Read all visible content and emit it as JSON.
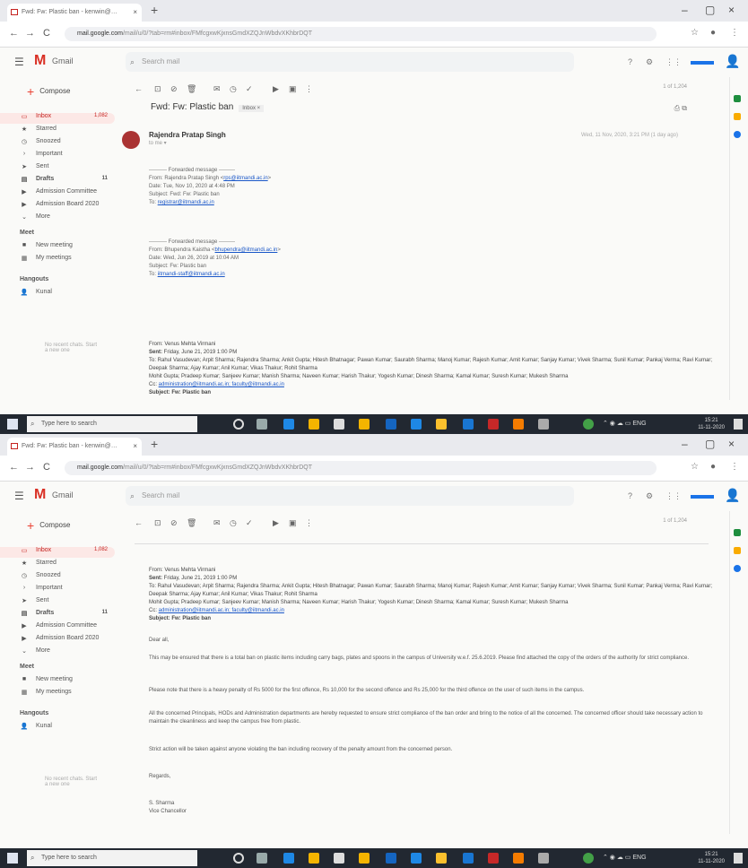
{
  "tab": {
    "title": "Fwd: Fw: Plastic ban - kenwin@…",
    "close": "×",
    "new": "+"
  },
  "window": {
    "minimize": "–",
    "maximize": "▢",
    "close": "×"
  },
  "nav": {
    "back": "←",
    "forward": "→",
    "reload": "C"
  },
  "address": {
    "url_host": "mail.google.com",
    "url_rest": "/mail/u/0/?tab=rm#inbox/FMfcgxwKjxnsGmdXZQJnWbdvXKhbrDQT",
    "star": "☆",
    "profile": "●",
    "menu": "⋮"
  },
  "gmail": {
    "logo": "M",
    "wordmark": "Gmail",
    "search_placeholder": "Search mail",
    "help": "?",
    "settings": "⚙",
    "apps": "⋮⋮"
  },
  "sidebar": {
    "compose": "Compose",
    "items": [
      {
        "icon": "▭",
        "label": "Inbox",
        "count": "1,082",
        "active": true
      },
      {
        "icon": "★",
        "label": "Starred",
        "count": ""
      },
      {
        "icon": "◷",
        "label": "Snoozed",
        "count": ""
      },
      {
        "icon": "›",
        "label": "Important",
        "count": ""
      },
      {
        "icon": "➤",
        "label": "Sent",
        "count": ""
      },
      {
        "icon": "▤",
        "label": "Drafts",
        "count": "11"
      },
      {
        "icon": "▶",
        "label": "Admission Committee",
        "count": ""
      },
      {
        "icon": "▶",
        "label": "Admission Board 2020",
        "count": ""
      },
      {
        "icon": "⌄",
        "label": "More",
        "count": ""
      }
    ],
    "meet_heading": "Meet",
    "meet_items": [
      {
        "icon": "■",
        "label": "New meeting"
      },
      {
        "icon": "▦",
        "label": "My meetings"
      }
    ],
    "hangouts_heading": "Hangouts",
    "hangouts_user": "Kunal",
    "footer": "No recent chats. Start a new one"
  },
  "toolbar": {
    "icons": [
      "←",
      "⊡",
      "⊘",
      "🗑",
      "✉",
      "◷",
      "✓",
      "▶",
      "▣",
      "⋮"
    ],
    "pagecount": "1 of 1,204"
  },
  "email": {
    "subject": "Fwd: Fw: Plastic ban",
    "subject_tag": "Inbox ×",
    "sender": "Rajendra Pratap Singh",
    "sender_to": "to me ▾",
    "date": "Wed, 11 Nov, 2020, 3:21 PM (1 day ago)",
    "fwd1": {
      "marker": "---------- Forwarded message ---------",
      "from": "From: Rajendra Pratap Singh <",
      "from_link": "rps@iitmandi.ac.in",
      "date": "Date: Tue, Nov 10, 2020 at 4:48 PM",
      "subject": "Subject: Fwd: Fw: Plastic ban",
      "to_label": "To: ",
      "to_link": "registrar@iitmandi.ac.in"
    },
    "fwd2": {
      "marker": "---------- Forwarded message ---------",
      "from": "From: Bhupendra Kaistha <",
      "from_link": "bhupendra@iitmandi.ac.in",
      "date": "Date: Wed, Jun 26, 2019 at 10:04 AM",
      "subject": "Subject: Fw: Plastic ban",
      "to_label": "To: ",
      "to_link": "iitmandi-staff@iitmandi.ac.in"
    },
    "meta": {
      "from": "From: Venus Mehta Virmani",
      "sent_label": "Sent:",
      "sent": " Friday, June 21, 2019 1:00 PM",
      "to_line": "To: Rahul Vasudevan; Arpit Sharma; Rajendra Sharma; Ankit Gupta; Hitesh Bhatnagar; Pawan Kumar; Saurabh Sharma; Manoj Kumar; Rajesh Kumar; Amit Kumar; Sanjay Kumar; Vivek Sharma; Sunil Kumar; Pankaj Verma; Ravi Kumar; Deepak Sharma; Ajay Kumar; Anil Kumar; Vikas Thakur; Rohit Sharma",
      "to_line2": "Mohit Gupta; Pradeep Kumar; Sanjeev Kumar; Manish Sharma; Naveen Kumar; Harish Thakur; Yogesh Kumar; Dinesh Sharma; Kamal Kumar; Suresh Kumar; Mukesh Sharma",
      "cc_label": "Cc: ",
      "cc_link": "administration@iitmandi.ac.in; faculty@iitmandi.ac.in",
      "subject": "Subject: Fw: Plastic ban"
    },
    "greeting": "Dear all,",
    "body": [
      "This may be ensured that there is a total ban on plastic items including carry bags, plates and spoons in the campus of University w.e.f. 25.6.2019. Please find attached the copy of the orders of the authority for strict compliance.",
      "Please note that there is a heavy penalty of Rs 5000 for the first offence, Rs 10,000 for the second offence and Rs 25,000 for the third offence on the user of such items in the campus.",
      "All the concerned Principals, HODs and Administration departments are hereby requested to ensure strict compliance of the ban order and bring to the notice of all the concerned. The concerned officer should take necessary action to maintain the cleanliness and keep the campus free from plastic.",
      "Strict action will be taken against anyone violating the ban including recovery of the penalty amount from the concerned person."
    ],
    "closing": "Regards,",
    "signature_name": "S. Sharma",
    "signature_title": "Vice Chancellor"
  },
  "taskbar": {
    "search_placeholder": "Type here to search",
    "tray": "⌃ ◉ ☁ ▭ ENG",
    "time": "15:21",
    "date": "11-11-2020"
  },
  "colors": {
    "gmail_red": "#d93025",
    "link": "#1a57c8",
    "taskbar": "#222831",
    "blue_accent": "#1a73e8"
  }
}
